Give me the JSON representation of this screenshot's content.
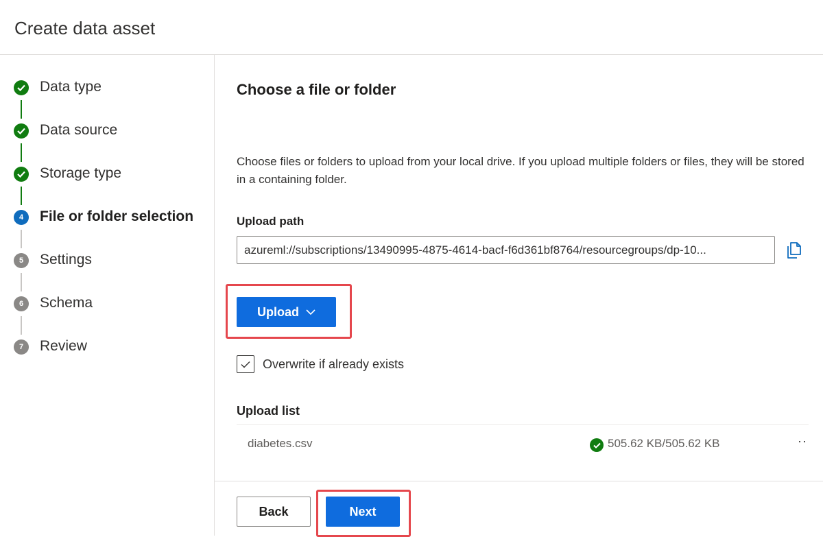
{
  "header": {
    "title": "Create data asset"
  },
  "steps": [
    {
      "number": "1",
      "label": "Data type",
      "state": "done"
    },
    {
      "number": "2",
      "label": "Data source",
      "state": "done"
    },
    {
      "number": "3",
      "label": "Storage type",
      "state": "done"
    },
    {
      "number": "4",
      "label": "File or folder selection",
      "state": "current"
    },
    {
      "number": "5",
      "label": "Settings",
      "state": "pending"
    },
    {
      "number": "6",
      "label": "Schema",
      "state": "pending"
    },
    {
      "number": "7",
      "label": "Review",
      "state": "pending"
    }
  ],
  "main": {
    "title": "Choose a file or folder",
    "description": "Choose files or folders to upload from your local drive. If you upload multiple folders or files, they will be stored in a containing folder.",
    "upload_path_label": "Upload path",
    "upload_path_value": "azureml://subscriptions/13490995-4875-4614-bacf-f6d361bf8764/resourcegroups/dp-10...",
    "upload_button": "Upload",
    "overwrite_label": "Overwrite if already exists",
    "overwrite_checked": true,
    "upload_list_title": "Upload list",
    "files": [
      {
        "name": "diabetes.csv",
        "size": "505.62 KB/505.62 KB",
        "status": "complete"
      }
    ]
  },
  "footer": {
    "back_label": "Back",
    "next_label": "Next"
  },
  "colors": {
    "done": "#107c10",
    "current": "#0f6cbd",
    "pending": "#8a8886",
    "primary_button": "#0f6cde",
    "highlight": "#e5474d"
  }
}
